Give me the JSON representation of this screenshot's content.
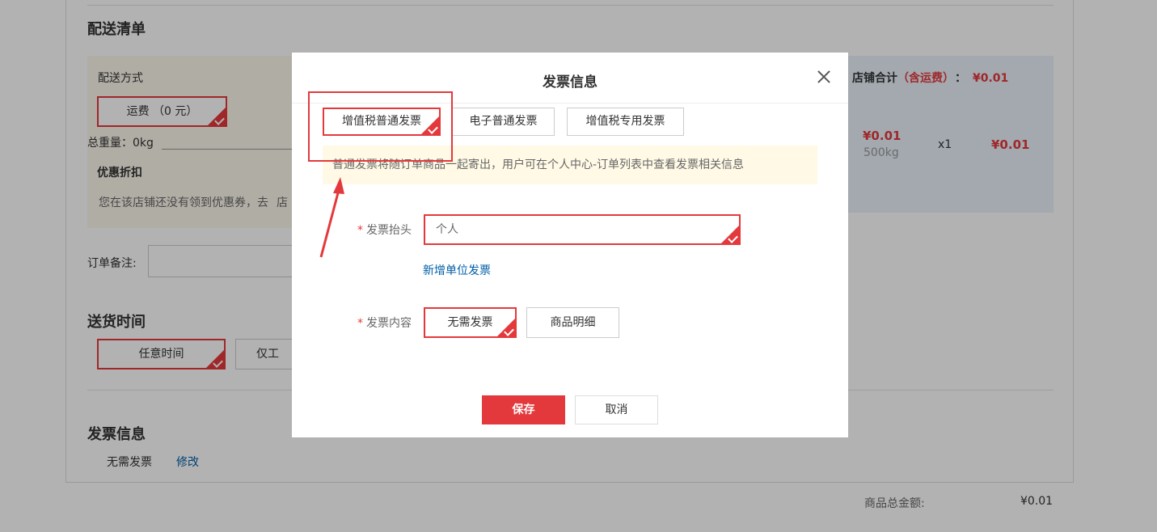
{
  "page": {
    "delivery_list_title": "配送清单",
    "delivery_method_label": "配送方式",
    "shipping_option": "运费 （0 元）",
    "total_weight": "总重量：0kg",
    "discount_title": "优惠折扣",
    "discount_text": "您在该店铺还没有领到优惠券，去",
    "discount_text_tail": "店",
    "order_remark_label": "订单备注:",
    "delivery_time_title": "送货时间",
    "time_option_selected": "任意时间",
    "time_option_other": "仅工",
    "invoice_title": "发票信息",
    "invoice_value": "无需发票",
    "invoice_edit": "修改",
    "store_total_label": "店铺合计",
    "store_total_note": "（含运费）",
    "store_total_colon": "：",
    "store_total_value": "¥0.01",
    "item_price": "¥0.01",
    "item_weight": "500kg",
    "item_qty": "x1",
    "item_subtotal": "¥0.01",
    "goods_total_label": "商品总金额:",
    "goods_total_value": "¥0.01"
  },
  "modal": {
    "title": "发票信息",
    "tabs": [
      {
        "label": "增值税普通发票",
        "selected": true
      },
      {
        "label": "电子普通发票",
        "selected": false
      },
      {
        "label": "增值税专用发票",
        "selected": false
      }
    ],
    "tip": "普通发票将随订单商品一起寄出，用户可在个人中心-订单列表中查看发票相关信息",
    "header_label": "发票抬头",
    "header_value": "个人",
    "add_company_link": "新增单位发票",
    "content_label": "发票内容",
    "content_options": [
      {
        "label": "无需发票",
        "selected": true
      },
      {
        "label": "商品明细",
        "selected": false
      }
    ],
    "required_mark": "*",
    "save_label": "保存",
    "cancel_label": "取消"
  },
  "colors": {
    "accent": "#e4393c",
    "link": "#005ea7",
    "tip_bg": "#fff9e6"
  }
}
